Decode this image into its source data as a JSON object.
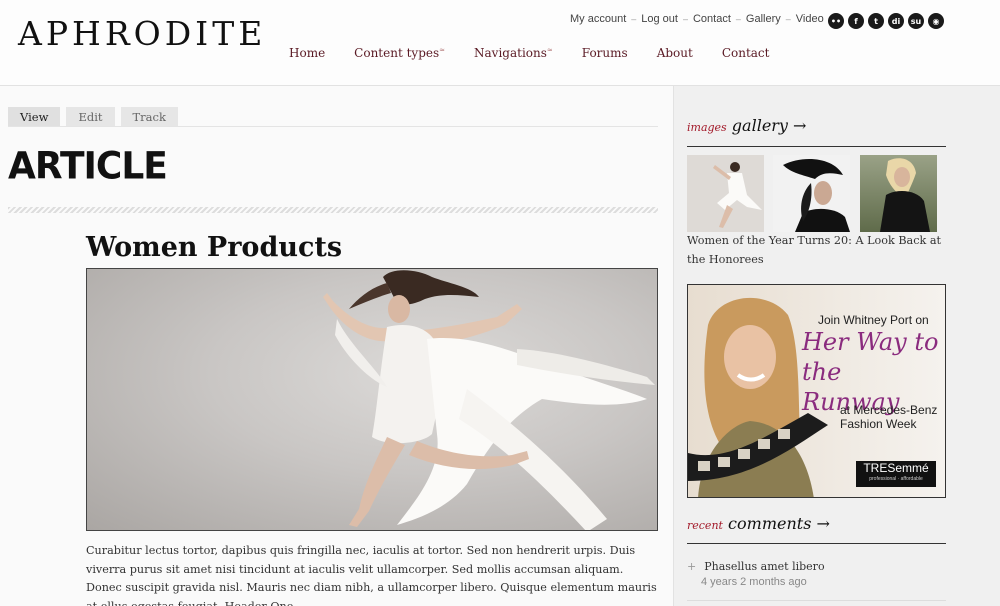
{
  "site": {
    "name": "APHRODITE"
  },
  "toplinks": [
    "My account",
    "Log out",
    "Contact",
    "Gallery",
    "Video"
  ],
  "social": [
    {
      "icon": "flickr-icon",
      "glyph": "••"
    },
    {
      "icon": "facebook-icon",
      "glyph": "f"
    },
    {
      "icon": "twitter-icon",
      "glyph": "t"
    },
    {
      "icon": "digg-icon",
      "glyph": "di"
    },
    {
      "icon": "stumbleupon-icon",
      "glyph": "su"
    },
    {
      "icon": "rss-icon",
      "glyph": "◉"
    }
  ],
  "mainnav": [
    {
      "label": "Home",
      "submenu": false
    },
    {
      "label": "Content types",
      "submenu": true
    },
    {
      "label": "Navigations",
      "submenu": true
    },
    {
      "label": "Forums",
      "submenu": false
    },
    {
      "label": "About",
      "submenu": false
    },
    {
      "label": "Contact",
      "submenu": false
    }
  ],
  "tabs": [
    {
      "label": "View",
      "active": true
    },
    {
      "label": "Edit",
      "active": false
    },
    {
      "label": "Track",
      "active": false
    }
  ],
  "page_title": "ARTICLE",
  "node": {
    "title": "Women Products",
    "body": "Curabitur lectus tortor, dapibus quis fringilla nec, iaculis at tortor. Sed non hendrerit urpis. Duis viverra purus sit amet nisi tincidunt at iaculis velit ullamcorper. Sed mollis accumsan aliquam. Donec suscipit gravida nisl. Mauris nec diam nibh, a ullamcorper libero. Quisque elementum mauris at ellus egestas feugiat. Header One"
  },
  "sidebar": {
    "gallery": {
      "prefix": "images",
      "title": "gallery →",
      "caption": "Women of the Year Turns 20: A Look Back at the Honorees"
    },
    "ad": {
      "line1": "Join Whitney Port on",
      "headline": "Her Way to the Runway",
      "line3": "at Mercedes-Benz Fashion Week",
      "brand": "TRESemmé",
      "brand_tagline": "professional · affordable"
    },
    "comments": {
      "prefix": "recent",
      "title": "comments →",
      "items": [
        {
          "title": "Phasellus amet libero",
          "time": "4 years 2 months ago"
        }
      ]
    }
  }
}
